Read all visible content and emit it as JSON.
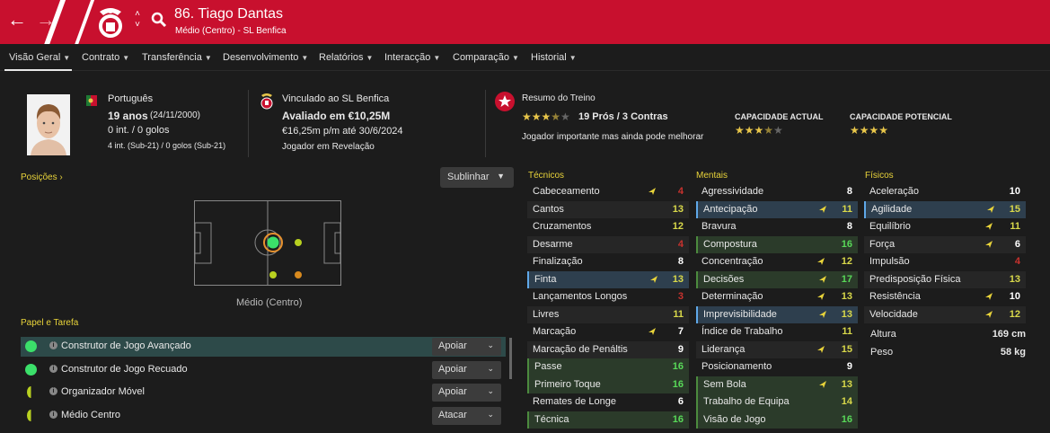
{
  "header": {
    "title": "86. Tiago Dantas",
    "subtitle": "Médio (Centro) - SL Benfica",
    "back_icon": "arrow-left-icon",
    "forward_icon": "arrow-right-icon",
    "search_icon": "search-icon",
    "brand_color": "#c8102e"
  },
  "tabs": [
    {
      "label": "Visão Geral"
    },
    {
      "label": "Contrato"
    },
    {
      "label": "Transferência"
    },
    {
      "label": "Desenvolvimento"
    },
    {
      "label": "Relatórios"
    },
    {
      "label": "Interacção"
    },
    {
      "label": "Comparação"
    },
    {
      "label": "Historial"
    }
  ],
  "profile": {
    "nationality": "Português",
    "age": "19 anos",
    "dob": "(24/11/2000)",
    "caps": "0 int. / 0 golos",
    "u21": "4 int. (Sub-21) / 0 golos (Sub-21)"
  },
  "contract": {
    "club": "Vinculado ao SL Benfica",
    "value": "Avaliado em €10,25M",
    "wage": "€16,25m p/m até 30/6/2024",
    "status": "Jogador em Revelação"
  },
  "training": {
    "title": "Resumo do Treino",
    "rating_stars": 3.5,
    "pros_cons": "19 Prós / 3 Contras",
    "note": "Jogador importante mas ainda pode melhorar",
    "ca_label": "CAPACIDADE ACTUAL",
    "ca_stars": 3.5,
    "pa_label": "CAPACIDADE POTENCIAL",
    "pa_stars": 4
  },
  "positions": {
    "label": "Posições",
    "highlight_button": "Sublinhar",
    "position_name": "Médio (Centro)"
  },
  "roles": {
    "label": "Papel e Tarefa",
    "items": [
      {
        "name": "Construtor de Jogo Avançado",
        "duty": "Apoiar",
        "selected": true
      },
      {
        "name": "Construtor de Jogo Recuado",
        "duty": "Apoiar"
      },
      {
        "name": "Organizador Móvel",
        "duty": "Apoiar"
      },
      {
        "name": "Médio Centro",
        "duty": "Atacar"
      }
    ]
  },
  "technical": {
    "label": "Técnicos",
    "rows": [
      {
        "name": "Cabeceamento",
        "value": "4",
        "color": "#c8322e",
        "arrow": true
      },
      {
        "name": "Cantos",
        "value": "13",
        "color": "#d8d84a"
      },
      {
        "name": "Cruzamentos",
        "value": "12",
        "color": "#d8d84a"
      },
      {
        "name": "Desarme",
        "value": "4",
        "color": "#c8322e"
      },
      {
        "name": "Finalização",
        "value": "8",
        "color": "#ffffff"
      },
      {
        "name": "Finta",
        "value": "13",
        "color": "#d8d84a",
        "arrow": true,
        "key": true
      },
      {
        "name": "Lançamentos Longos",
        "value": "3",
        "color": "#c8322e"
      },
      {
        "name": "Livres",
        "value": "11",
        "color": "#d8d84a"
      },
      {
        "name": "Marcação",
        "value": "7",
        "color": "#ffffff",
        "arrow": true
      },
      {
        "name": "Marcação de Penáltis",
        "value": "9",
        "color": "#ffffff"
      },
      {
        "name": "Passe",
        "value": "16",
        "color": "#58d858",
        "green": true
      },
      {
        "name": "Primeiro Toque",
        "value": "16",
        "color": "#58d858",
        "green": true
      },
      {
        "name": "Remates de Longe",
        "value": "6",
        "color": "#ffffff"
      },
      {
        "name": "Técnica",
        "value": "16",
        "color": "#58d858",
        "green": true
      }
    ]
  },
  "mental": {
    "label": "Mentais",
    "rows": [
      {
        "name": "Agressividade",
        "value": "8",
        "color": "#ffffff"
      },
      {
        "name": "Antecipação",
        "value": "11",
        "color": "#d8d84a",
        "arrow": true,
        "key": true
      },
      {
        "name": "Bravura",
        "value": "8",
        "color": "#ffffff"
      },
      {
        "name": "Compostura",
        "value": "16",
        "color": "#58d858",
        "green": true
      },
      {
        "name": "Concentração",
        "value": "12",
        "color": "#d8d84a",
        "arrow": true
      },
      {
        "name": "Decisões",
        "value": "17",
        "color": "#58d858",
        "arrow": true,
        "green": true
      },
      {
        "name": "Determinação",
        "value": "13",
        "color": "#d8d84a",
        "arrow": true
      },
      {
        "name": "Imprevisibilidade",
        "value": "13",
        "color": "#d8d84a",
        "arrow": true,
        "key": true
      },
      {
        "name": "Índice de Trabalho",
        "value": "11",
        "color": "#d8d84a"
      },
      {
        "name": "Liderança",
        "value": "15",
        "color": "#d8d84a",
        "arrow": true
      },
      {
        "name": "Posicionamento",
        "value": "9",
        "color": "#ffffff"
      },
      {
        "name": "Sem Bola",
        "value": "13",
        "color": "#d8d84a",
        "arrow": true,
        "green": true
      },
      {
        "name": "Trabalho de Equipa",
        "value": "14",
        "color": "#d8d84a",
        "green": true
      },
      {
        "name": "Visão de Jogo",
        "value": "16",
        "color": "#58d858",
        "green": true
      }
    ]
  },
  "physical": {
    "label": "Físicos",
    "rows": [
      {
        "name": "Aceleração",
        "value": "10",
        "color": "#ffffff"
      },
      {
        "name": "Agilidade",
        "value": "15",
        "color": "#d8d84a",
        "arrow": true,
        "key": true
      },
      {
        "name": "Equilíbrio",
        "value": "11",
        "color": "#d8d84a",
        "arrow": true
      },
      {
        "name": "Força",
        "value": "6",
        "color": "#ffffff",
        "arrow": true
      },
      {
        "name": "Impulsão",
        "value": "4",
        "color": "#c8322e"
      },
      {
        "name": "Predisposição Física",
        "value": "13",
        "color": "#d8d84a"
      },
      {
        "name": "Resistência",
        "value": "10",
        "color": "#ffffff",
        "arrow": true
      },
      {
        "name": "Velocidade",
        "value": "12",
        "color": "#d8d84a",
        "arrow": true
      }
    ],
    "height_label": "Altura",
    "height": "169 cm",
    "weight_label": "Peso",
    "weight": "58 kg"
  }
}
